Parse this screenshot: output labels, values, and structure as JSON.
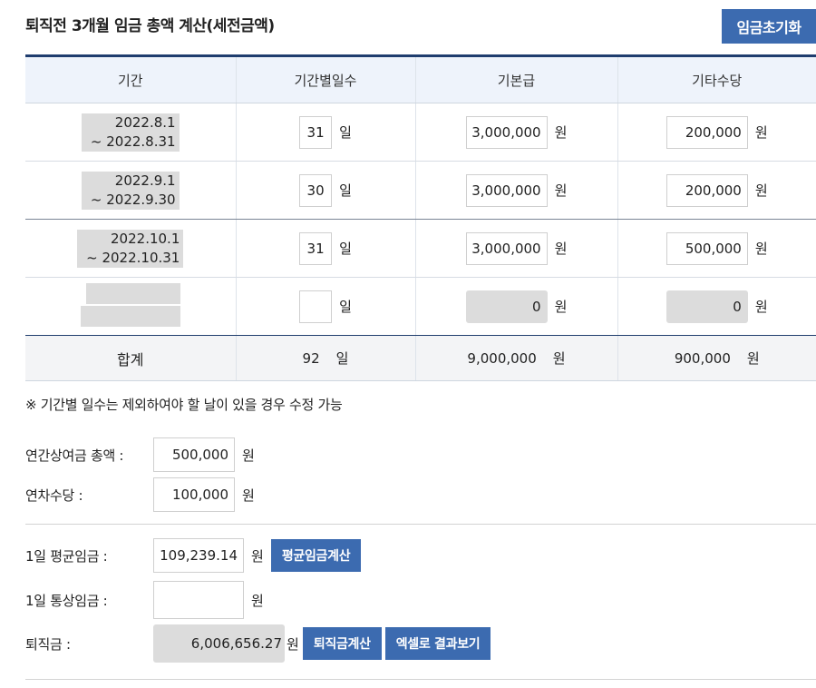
{
  "header": {
    "title": "퇴직전 3개월 임금 총액 계산(세전금액)",
    "reset_button": "임금초기화"
  },
  "table": {
    "columns": [
      "기간",
      "기간별일수",
      "기본급",
      "기타수당"
    ],
    "rows": [
      {
        "period_start": "2022.8.1",
        "period_end": "~ 2022.8.31",
        "days": "31",
        "base": "3,000,000",
        "other": "200,000"
      },
      {
        "period_start": "2022.9.1",
        "period_end": "~ 2022.9.30",
        "days": "30",
        "base": "3,000,000",
        "other": "200,000"
      },
      {
        "period_start": "2022.10.1",
        "period_end": "~ 2022.10.31",
        "days": "31",
        "base": "3,000,000",
        "other": "500,000"
      },
      {
        "period_start": "",
        "period_end": "",
        "days": "",
        "base": "0",
        "other": "0"
      }
    ],
    "total": {
      "label": "합계",
      "days": "92",
      "base": "9,000,000",
      "other": "900,000"
    },
    "unit_day": "일",
    "unit_won": "원"
  },
  "note": "※ 기간별 일수는 제외하여야 할 날이 있을 경우 수정 가능",
  "form": {
    "annual_bonus": {
      "label": "연간상여금 총액 :",
      "value": "500,000"
    },
    "annual_leave": {
      "label": "연차수당 :",
      "value": "100,000"
    },
    "avg_daily_wage": {
      "label": "1일 평균임금 :",
      "value": "109,239.14",
      "button": "평균임금계산"
    },
    "ordinary_daily_wage": {
      "label": "1일 통상임금 :",
      "value": ""
    },
    "severance": {
      "label": "퇴직금 :",
      "value": "6,006,656.27",
      "button": "퇴직금계산",
      "excel_button": "엑셀로 결과보기"
    },
    "unit_won": "원"
  }
}
